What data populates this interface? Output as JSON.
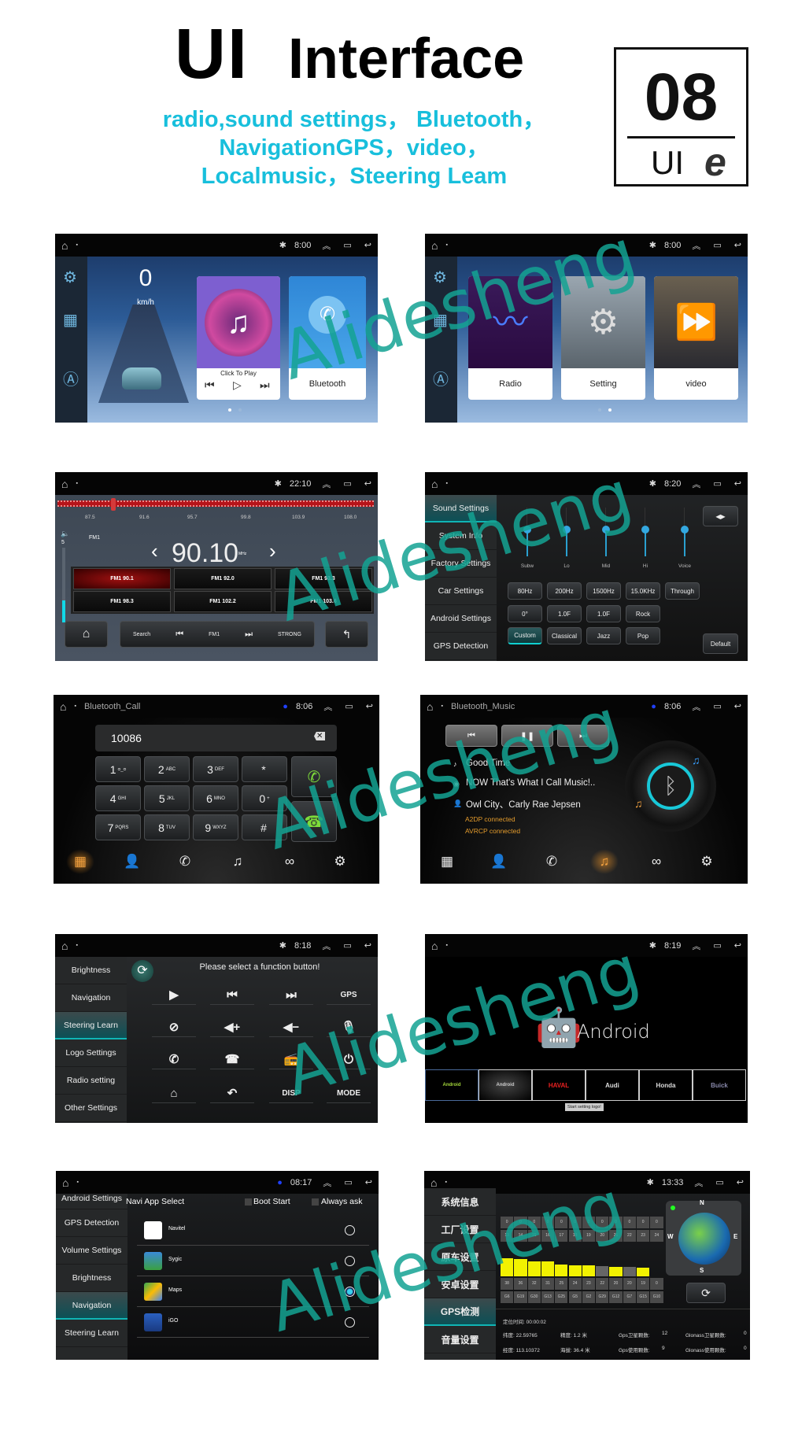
{
  "header": {
    "title_ui": "UI",
    "title_interface": "Interface",
    "subtitle_lines": [
      "radio,sound settings，  Bluetooth，",
      "NavigationGPS，video，",
      " Localmusic，Steering Leam"
    ],
    "badge_number": "08",
    "badge_label": "UI",
    "badge_logo": "e"
  },
  "watermark": "Alidesheng",
  "colors": {
    "accent": "#18bfdc",
    "teal": "#10b5b5",
    "orange": "#e39b2c",
    "gps_bar": "#f2f200"
  },
  "home1": {
    "time": "8:00",
    "speed": "0",
    "speed_unit": "km/h",
    "music_card": {
      "caption": "Click To Play"
    },
    "bluetooth_card": {
      "label": "Bluetooth"
    },
    "page": 1,
    "pages": 2
  },
  "home2": {
    "time": "8:00",
    "cards": [
      "Radio",
      "Setting",
      "video"
    ],
    "page": 2,
    "pages": 2
  },
  "radio": {
    "time": "22:10",
    "band": "FM1",
    "frequency": "90.10",
    "unit": "MHz",
    "volume": "5",
    "volume_level": 0.3,
    "scale_labels": [
      "87.5",
      "91.6",
      "95.7",
      "99.8",
      "103.9",
      "108.0"
    ],
    "presets": [
      "FM1 90.1",
      "FM1 92.0",
      "FM1 93.3",
      "FM1 98.3",
      "FM1 102.2",
      "FM1 103.6"
    ],
    "controls": {
      "search": "Search",
      "band": "FM1",
      "strong": "STRONG"
    }
  },
  "sound": {
    "time": "8:20",
    "menu": [
      "Sound Settings",
      "System Info",
      "Factory Settings",
      "Car Settings",
      "Android Settings",
      "GPS Detection"
    ],
    "active": 0,
    "sliders": [
      "Subw",
      "Lo",
      "Mid",
      "Hi",
      "Voice"
    ],
    "row1": [
      "80Hz",
      "200Hz",
      "1500Hz",
      "15.0KHz",
      "Through"
    ],
    "row2": [
      "0°",
      "1.0F",
      "1.0F",
      "Rock"
    ],
    "row3": [
      "Custom",
      "Classical",
      "Jazz",
      "Pop"
    ],
    "default_label": "Default"
  },
  "bt_call": {
    "title": "Bluetooth_Call",
    "time": "8:06",
    "number": "10086",
    "keys": [
      [
        "1",
        "ᴑ_ᴑ"
      ],
      [
        "2",
        "ABC"
      ],
      [
        "3",
        "DEF"
      ],
      [
        "*",
        ""
      ],
      [
        "4",
        "GHI"
      ],
      [
        "5",
        "JKL"
      ],
      [
        "6",
        "MNO"
      ],
      [
        "0",
        "+"
      ],
      [
        "7",
        "PQRS"
      ],
      [
        "8",
        "TUV"
      ],
      [
        "9",
        "WXYZ"
      ],
      [
        "#",
        ""
      ]
    ],
    "nav_icons": [
      "dialpad-icon",
      "contacts-icon",
      "call-log-icon",
      "music-icon",
      "link-icon",
      "settings-icon"
    ],
    "active_nav": 0
  },
  "bt_music": {
    "title": "Bluetooth_Music",
    "time": "8:06",
    "song": "Good Time",
    "album": "NOW That's What I Call Music!..",
    "artist": "Owl City、Carly Rae Jepsen",
    "status": [
      "A2DP connected",
      "AVRCP connected"
    ],
    "active_nav": 3
  },
  "steering": {
    "time": "8:18",
    "menu": [
      "Brightness",
      "Navigation",
      "Steering Learn",
      "Logo Settings",
      "Radio setting",
      "Other Settings"
    ],
    "active": 2,
    "prompt": "Please select a function button!",
    "functions": [
      "▶",
      "⏮",
      "⏭",
      "GPS",
      "⊘",
      "◀+",
      "◀−",
      "🎙",
      "✆",
      "☎",
      "📻",
      "⏻",
      "⌂",
      "↶",
      "DISP",
      "MODE"
    ]
  },
  "logo": {
    "time": "8:19",
    "brand": "Android",
    "logos": [
      "Android",
      "Android",
      "HAVAL",
      "Audi",
      "Honda",
      "Buick"
    ],
    "toast": "Start setting logo!"
  },
  "navi": {
    "time": "08:17",
    "menu": [
      "Android Settings",
      "GPS Detection",
      "Volume Settings",
      "Brightness",
      "Navigation",
      "Steering Learn"
    ],
    "active": 4,
    "title": "Navi App Select",
    "boot_start": "Boot Start",
    "always_ask": "Always ask",
    "apps": [
      "Navitel",
      "Sygic",
      "Maps",
      "iGO"
    ],
    "selected": 2
  },
  "gps": {
    "time": "13:33",
    "menu": [
      "系统信息",
      "工厂设置",
      "原车设置",
      "安卓设置",
      "GPS检测",
      "音量设置"
    ],
    "active": 4,
    "glonass_snr": [
      "0",
      "0",
      "0",
      "0",
      "0",
      "0",
      "0",
      "0",
      "0",
      "0",
      "0",
      "0"
    ],
    "glonass_ids": [
      "13",
      "14",
      "15",
      "16",
      "17",
      "18",
      "19",
      "20",
      "21",
      "22",
      "23",
      "24"
    ],
    "gps_snr": [
      38,
      36,
      32,
      31,
      25,
      24,
      23,
      22,
      20,
      20,
      19,
      0
    ],
    "gps_ids": [
      "G6",
      "G19",
      "G30",
      "G13",
      "G25",
      "G5",
      "G2",
      "G29",
      "G12",
      "G7",
      "G15",
      "G10"
    ],
    "gps_used": [
      true,
      true,
      true,
      true,
      true,
      true,
      true,
      false,
      true,
      false,
      true,
      false
    ],
    "compass": [
      "N",
      "E",
      "S",
      "W"
    ],
    "fix_time": "定位时间: 00:00:02",
    "lat": "纬度: 22.59765",
    "lon": "经度: 113.10372",
    "accuracy": "精度: 1.2 米",
    "altitude": "海拔: 36.4 米",
    "gps_sat_label": "Gps卫星颗数:",
    "gps_sat": "12",
    "gps_used_label": "Gps使用颗数:",
    "gps_used_count": "9",
    "glonass_sat_label": "Glonass卫星颗数:",
    "glonass_sat": "0",
    "glonass_used_label": "Glonass使用颗数:",
    "glonass_used_count": "0"
  }
}
